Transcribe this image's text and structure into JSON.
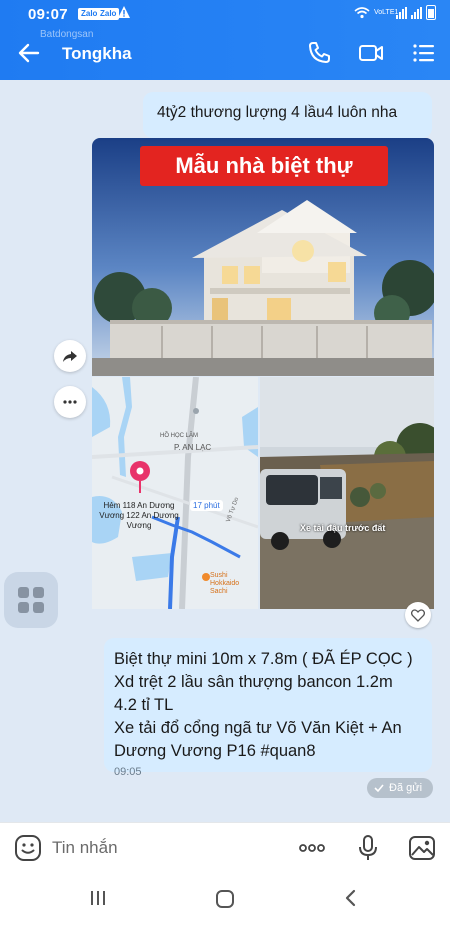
{
  "status_bar": {
    "time": "09:07",
    "badge_1": "Zalo",
    "badge_2": "Zalo",
    "network": "VoLTE1"
  },
  "watermark": "Batdongsan",
  "header": {
    "contact_name": "Tongkha"
  },
  "messages": {
    "top_text": "4tỷ2 thương lượng 4 lầu4 luôn nha",
    "photo_label": "Mẫu nhà biệt thự",
    "map": {
      "label_top": "HỒ HỌC LÃM",
      "label_ward": "P. AN LẠC",
      "pin_label": "Hẻm 118 An Dương Vương 122 An Dương Vương",
      "route_time": "17 phút",
      "poi": "Sushi Hokkaido Sachi",
      "road": "Võ Tự Do"
    },
    "truck_caption": "Xe tải đậu trước đất",
    "main_lines": [
      "Biệt thự mini 10m x 7.8m ( ĐÃ ÉP CỌC )",
      "Xd trệt 2 lầu sân thượng bancon 1.2m",
      "4.2 tỉ TL",
      "Xe tải đổ cổng ngã tư Võ Văn Kiệt + An",
      "Dương Vương P16 #quan8"
    ],
    "main_time": "09:05",
    "sent_status": "Đã gửi"
  },
  "input": {
    "placeholder": "Tin nhắn"
  },
  "icons": {
    "back": "arrow-left-icon",
    "call": "phone-icon",
    "video": "video-camera-icon",
    "menu": "list-menu-icon",
    "forward": "share-arrow-icon",
    "more": "more-horizontal-icon",
    "react": "heart-icon",
    "apps": "apps-grid-icon",
    "emoji": "emoji-icon",
    "mic": "microphone-icon",
    "gallery": "image-icon"
  },
  "colors": {
    "header": "#1f7bf2",
    "bubble": "#d6ecff",
    "chat_bg": "#dfe9f5",
    "label_red": "#e32420"
  }
}
